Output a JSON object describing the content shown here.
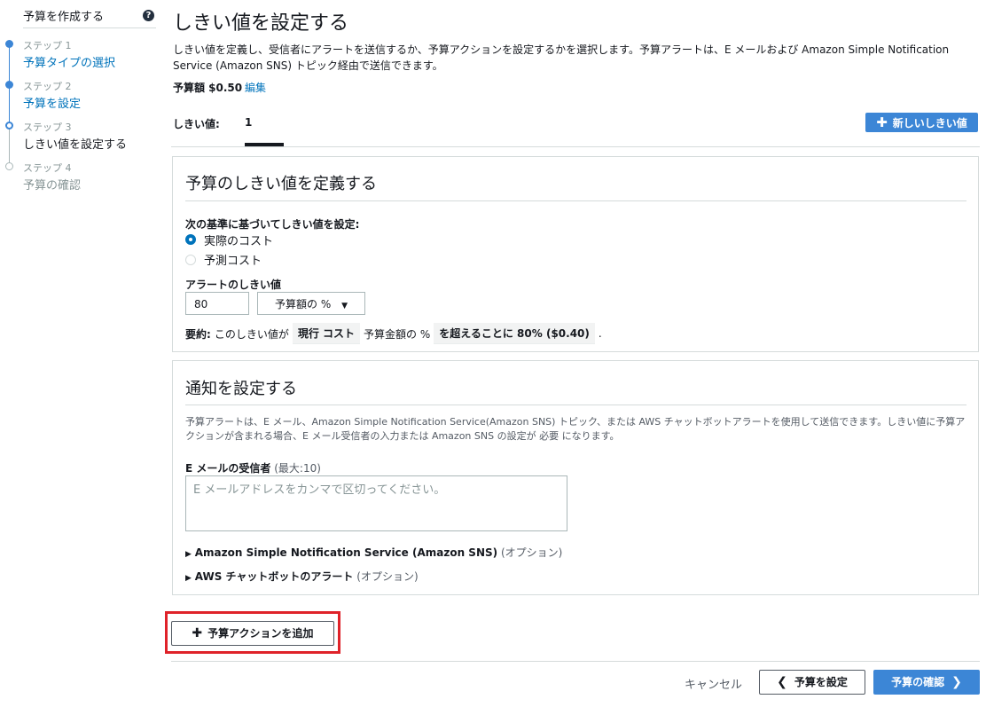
{
  "sidebar": {
    "title": "予算を作成する",
    "help": "?",
    "steps": [
      {
        "caption": "ステップ 1",
        "label": "予算タイプの選択"
      },
      {
        "caption": "ステップ 2",
        "label": "予算を設定"
      },
      {
        "caption": "ステップ 3",
        "label": "しきい値を設定する"
      },
      {
        "caption": "ステップ 4",
        "label": "予算の確認"
      }
    ]
  },
  "page": {
    "title": "しきい値を設定する",
    "description": "しきい値を定義し、受信者にアラートを送信するか、予算アクションを設定するかを選択します。予算アラートは、E メールおよび Amazon Simple Notification Service (Amazon SNS) トピック経由で送信できます。",
    "budget_amount": "予算額 $0.50",
    "edit_link": "編集"
  },
  "tabs": {
    "label": "しきい値:",
    "active": "1",
    "new_button": "新しいしきい値"
  },
  "threshold_panel": {
    "title": "予算のしきい値を定義する",
    "basis_label": "次の基準に基づいてしきい値を設定:",
    "options": [
      "実際のコスト",
      "予測コスト"
    ],
    "selected_option": "実際のコスト",
    "alert_label": "アラートのしきい値",
    "threshold_value": "80",
    "unit_select": "予算額の %",
    "summary_prefix": "要約:",
    "summary_text1": "このしきい値が",
    "summary_pill1": "現行 コスト",
    "summary_text2": "予算金額の %",
    "summary_pill2": "を超えることに 80% ($0.40)",
    "summary_end": "."
  },
  "notify_panel": {
    "title": "通知を設定する",
    "desc": "予算アラートは、E メール、Amazon Simple Notification Service(Amazon SNS) トピック、または AWS チャットボットアラートを使用して送信できます。しきい値に予算アクションが含まれる場合、E メール受信者の入力または Amazon SNS の設定が 必要 になります。",
    "email_label": "E メールの受信者",
    "email_hint": "(最大:10)",
    "email_placeholder": "E メールアドレスをカンマで区切ってください。",
    "sns_label": "Amazon Simple Notification Service (Amazon SNS)",
    "sns_hint": "(オプション)",
    "chatbot_label": "AWS チャットボットのアラート",
    "chatbot_hint": "(オプション)"
  },
  "actions": {
    "add_action": "予算アクションを追加",
    "cancel": "キャンセル",
    "back": "予算を設定",
    "next": "予算の確認"
  },
  "colors": {
    "primary": "#3c86d6",
    "link": "#0073bb",
    "highlight": "#df2229"
  }
}
